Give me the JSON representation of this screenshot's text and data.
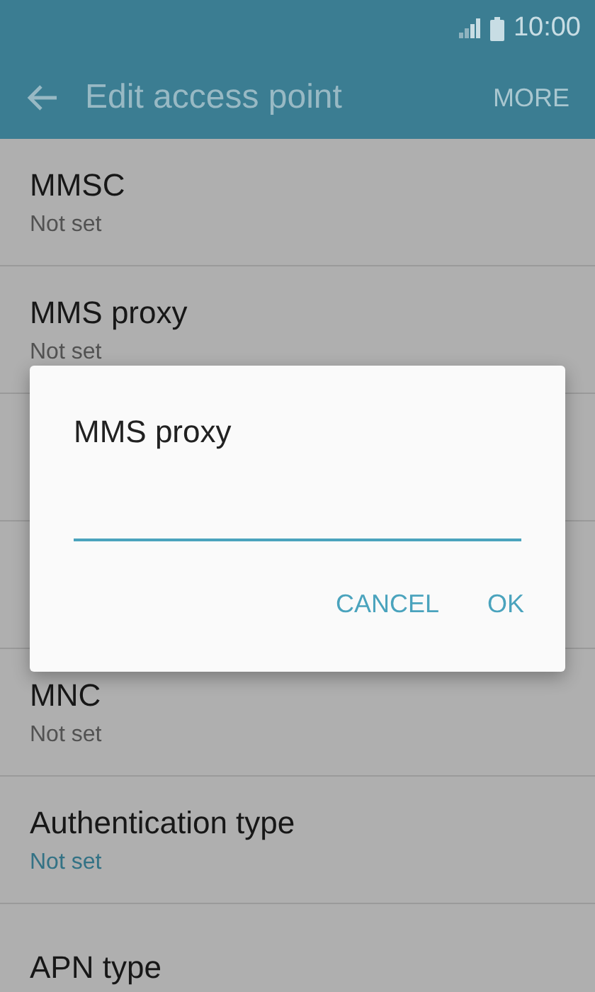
{
  "status_bar": {
    "time": "10:00"
  },
  "app_bar": {
    "title": "Edit access point",
    "action": "MORE"
  },
  "settings": [
    {
      "kind": "row",
      "title": "MMSC",
      "value": "Not set",
      "color": "#525252"
    },
    {
      "kind": "row",
      "title": "MMS proxy",
      "value": "Not set",
      "color": "#525252"
    },
    {
      "kind": "hidden"
    },
    {
      "kind": "hidden"
    },
    {
      "kind": "row",
      "title": "MNC",
      "value": "Not set",
      "color": "#525252"
    },
    {
      "kind": "row",
      "title": "Authentication type",
      "value": "Not set",
      "color": "#337285"
    },
    {
      "kind": "row",
      "title": "APN type"
    }
  ],
  "dialog": {
    "title": "MMS proxy",
    "buttons": [
      "CANCEL",
      "OK"
    ]
  }
}
